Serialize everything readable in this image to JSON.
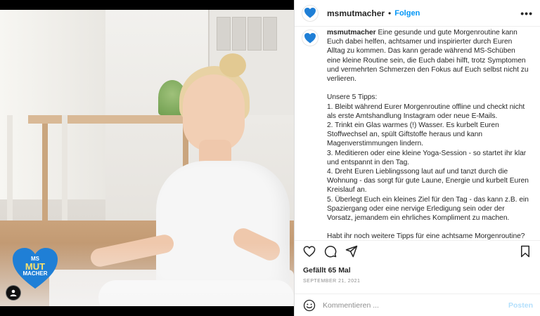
{
  "post": {
    "author": "msmutmacher",
    "separator": "•",
    "follow_label": "Folgen",
    "more_label": "•••",
    "caption": "Eine gesunde und gute Morgenroutine kann Euch dabei helfen, achtsamer und inspirierter durch Euren Alltag zu kommen. Das kann gerade während MS-Schüben eine kleine Routine sein, die Euch dabei hilft, trotz Symptomen und vermehrten Schmerzen den Fokus auf Euch selbst nicht zu verlieren.\n\nUnsere 5 Tipps:\n1. Bleibt während Eurer Morgenroutine offline und checkt nicht als erste Amtshandlung Instagram oder neue E-Mails.\n2. Trinkt ein Glas warmes (!) Wasser. Es kurbelt Euren Stoffwechsel an, spült Giftstoffe heraus und kann Magenverstimmungen lindern.\n3. Meditieren oder eine kleine Yoga-Session - so startet ihr klar und entspannt in den Tag.\n4. Dreht Euren Lieblingssong laut auf und tanzt durch die Wohnung - das sorgt für gute Laune, Energie und kurbelt Euren Kreislauf an.\n5. Überlegt Euch ein kleines Ziel für den Tag - das kann z.B. ein Spaziergang oder eine nervige Erledigung sein oder der Vorsatz, jemandem ein ehrliches Kompliment zu machen.\n\nHabt ihr noch weitere Tipps für eine achtsame Morgenroutine?",
    "likes": "Gefällt 65 Mal",
    "date": "SEPTEMBER 21, 2021"
  },
  "logo": {
    "line1": "MS",
    "line2": "MUT",
    "line3": "MACHER",
    "heart_color": "#1f7fd6",
    "accent_color": "#ffe36b"
  },
  "comment": {
    "placeholder": "Kommentieren ...",
    "post_label": "Posten"
  },
  "icons": [
    "heart-icon",
    "comment-icon",
    "share-icon",
    "bookmark-icon",
    "emoji-icon",
    "user-tag-icon",
    "more-icon"
  ],
  "colors": {
    "link_blue": "#0095f6",
    "text": "#262626",
    "muted": "#8e8e8e"
  }
}
